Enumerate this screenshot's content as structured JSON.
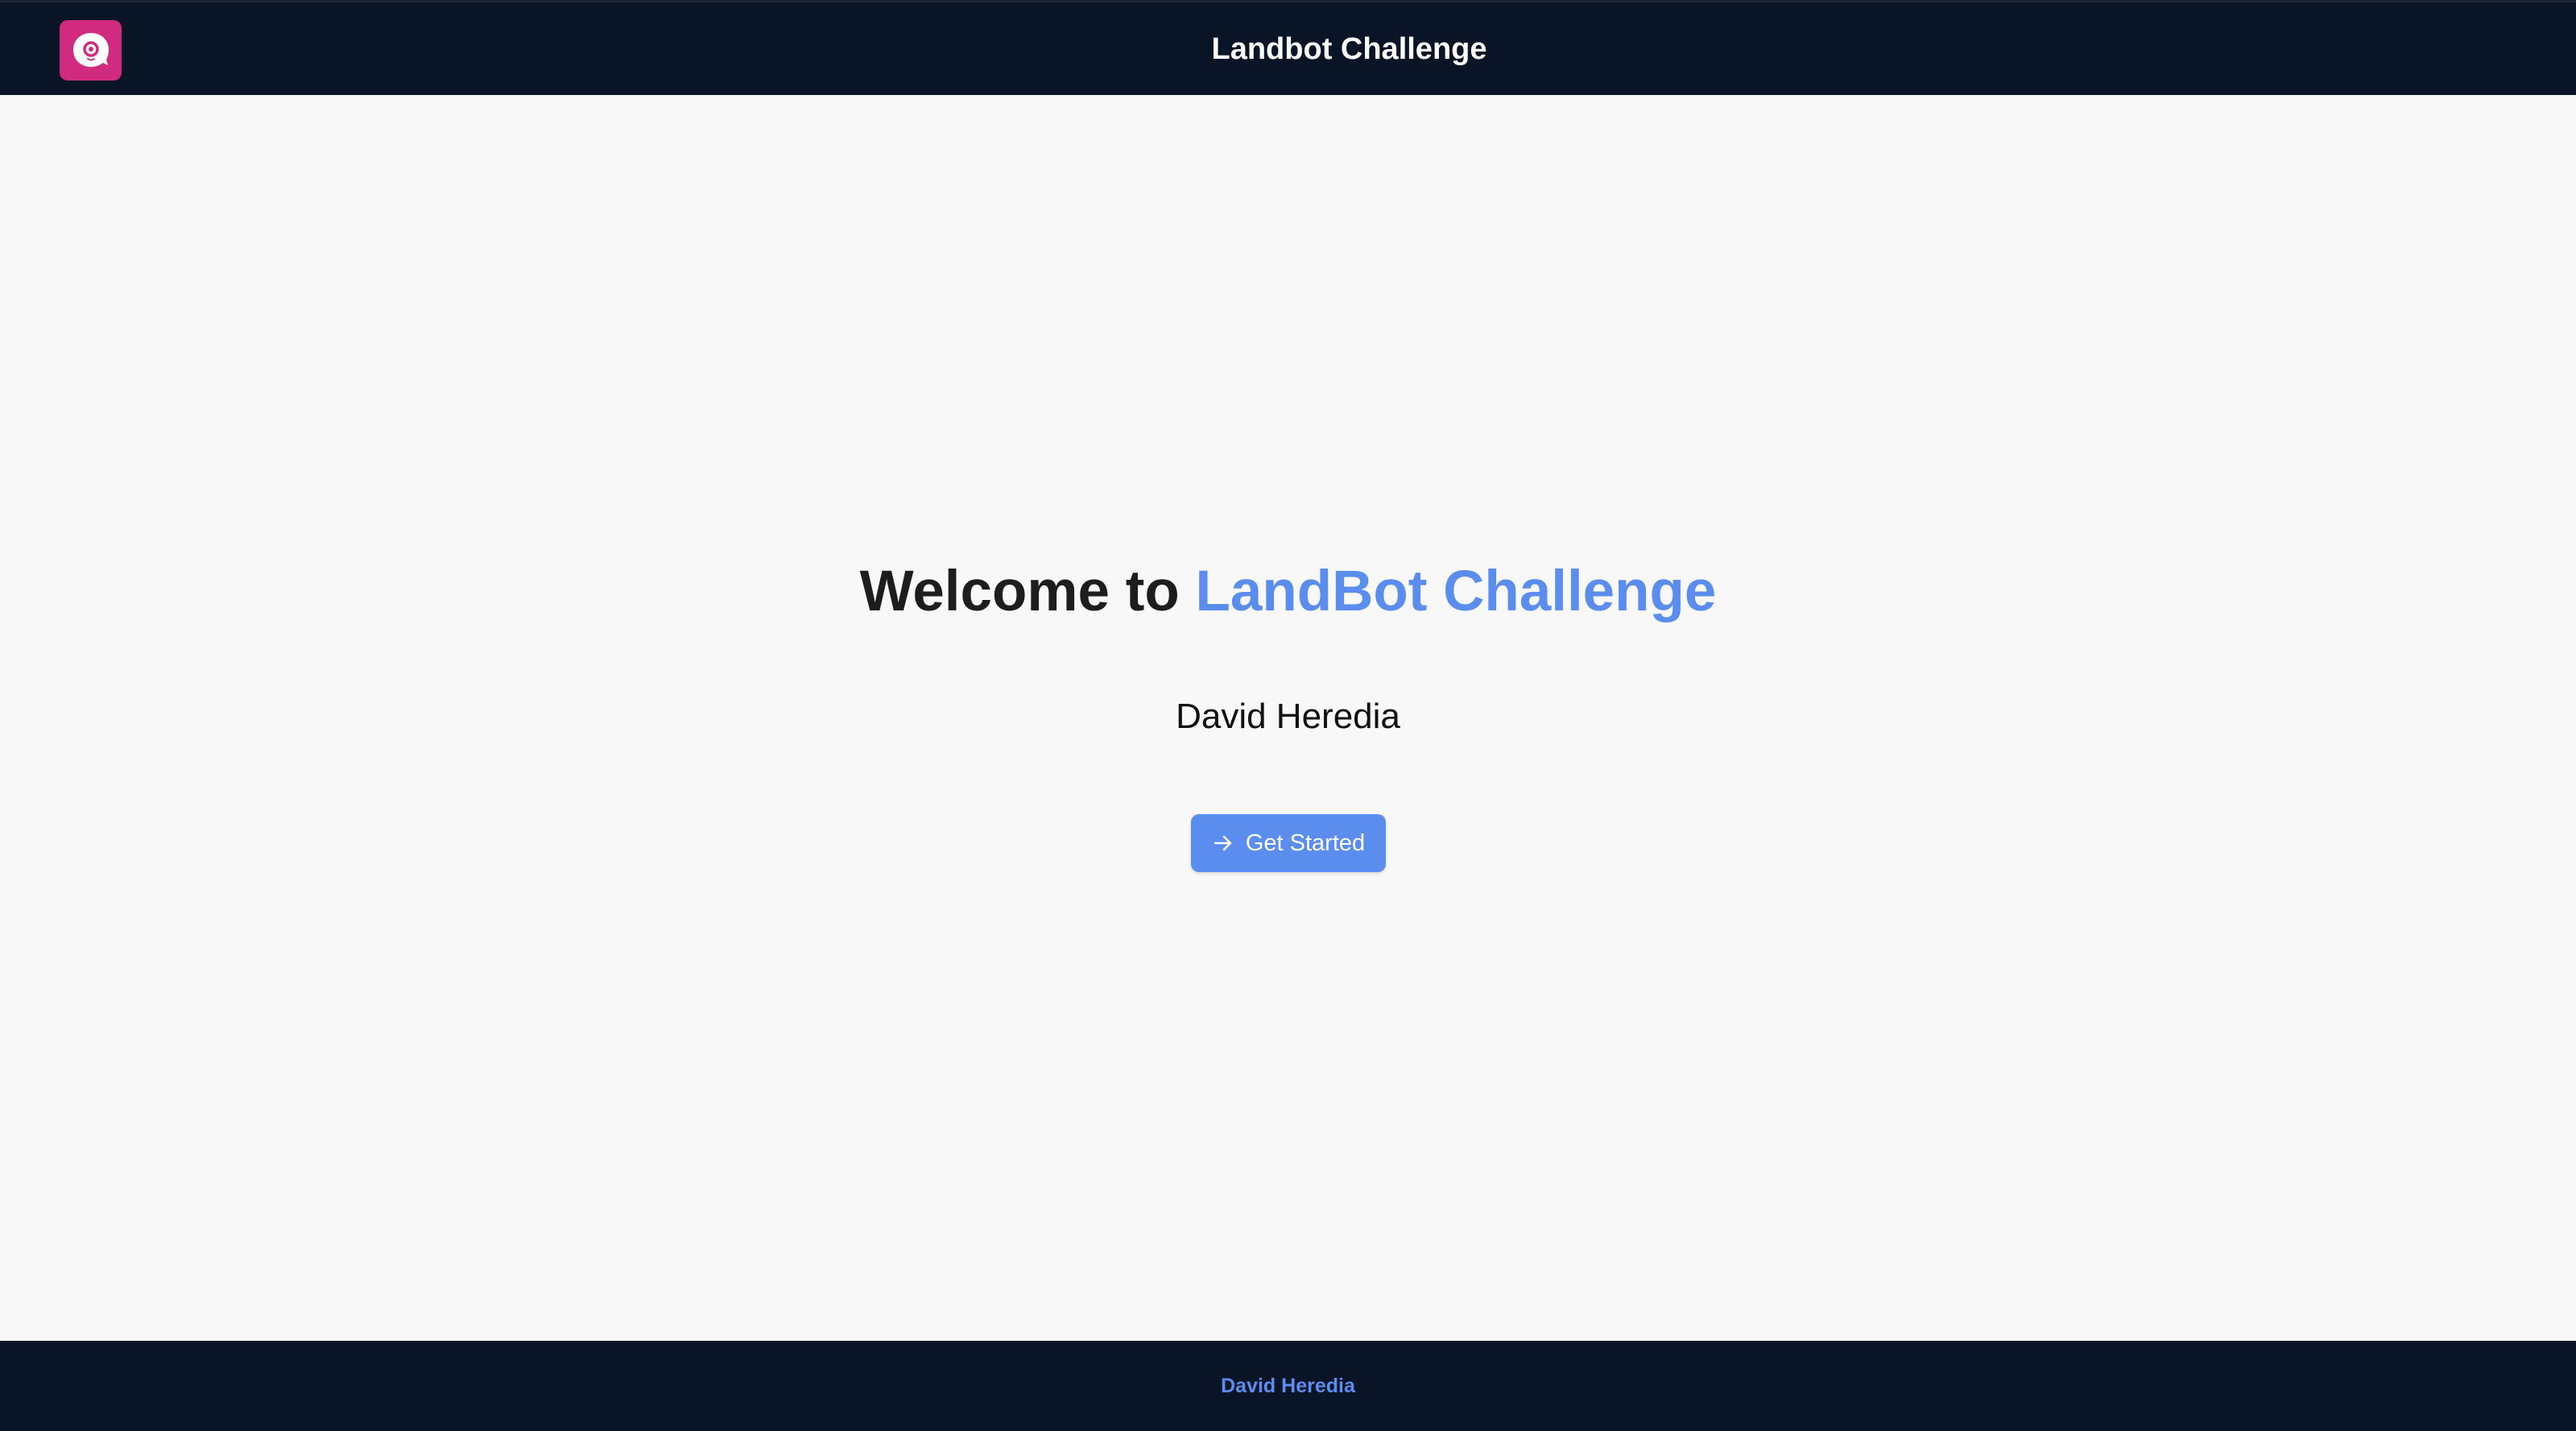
{
  "header": {
    "title": "Landbot Challenge",
    "logo_icon": "chat-bubble-eye-icon",
    "logo_color": "#d12b7f"
  },
  "hero": {
    "title_prefix": "Welcome to ",
    "title_accent": "LandBot Challenge",
    "author": "David Heredia",
    "cta": {
      "label": "Get Started",
      "icon": "arrow-right-icon"
    }
  },
  "footer": {
    "link": "David Heredia"
  },
  "colors": {
    "header_bg": "#091427",
    "page_bg": "#f8f8f8",
    "accent": "#5b8def"
  }
}
